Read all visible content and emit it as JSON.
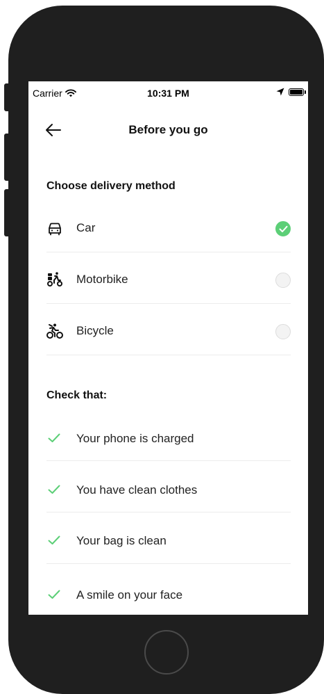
{
  "status_bar": {
    "carrier": "Carrier",
    "time": "10:31 PM",
    "icons": [
      "wifi-icon",
      "location-arrow-icon",
      "battery-icon"
    ]
  },
  "nav": {
    "title": "Before you go",
    "back_icon": "arrow-left-icon"
  },
  "delivery": {
    "heading": "Choose delivery method",
    "options": [
      {
        "label": "Car",
        "icon": "car-icon",
        "selected": true
      },
      {
        "label": "Motorbike",
        "icon": "motorbike-icon",
        "selected": false
      },
      {
        "label": "Bicycle",
        "icon": "bicycle-icon",
        "selected": false
      }
    ]
  },
  "checklist": {
    "heading": "Check that:",
    "items": [
      {
        "label": "Your phone is charged",
        "icon": "check-icon"
      },
      {
        "label": "You have clean clothes",
        "icon": "check-icon"
      },
      {
        "label": "Your bag is clean",
        "icon": "check-icon"
      },
      {
        "label": "A smile on your face",
        "icon": "check-icon"
      }
    ]
  },
  "colors": {
    "accent": "#5ccf77",
    "device": "#1f1f1f",
    "divider": "#ececec"
  }
}
